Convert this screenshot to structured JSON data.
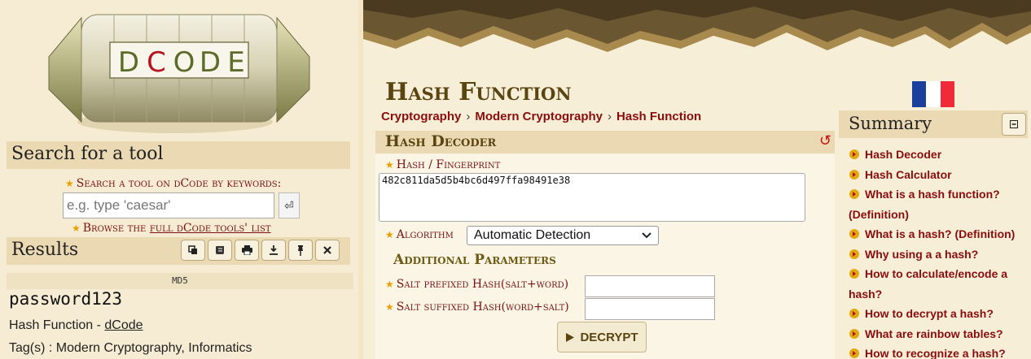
{
  "left": {
    "logo_letters": [
      "D",
      "C",
      "O",
      "D",
      "E"
    ],
    "search_section_title": "Search for a tool",
    "search_label": "Search a tool on dCode by keywords:",
    "search_placeholder": "e.g. type 'caesar'",
    "browse_prefix": "Browse the ",
    "browse_link": "full dCode tools' list",
    "results_section_title": "Results",
    "toolbar_icons": [
      "copy-icon",
      "script-icon",
      "print-icon",
      "download-icon",
      "pin-icon",
      "close-icon"
    ],
    "result_type": "MD5",
    "result_value": "password123",
    "result_source_prefix": "Hash Function - ",
    "result_source_link": "dCode",
    "result_tags": "Tag(s) : Modern Cryptography, Informatics"
  },
  "main": {
    "page_title": "Hash Function",
    "breadcrumb": [
      "Cryptography",
      "Modern Cryptography",
      "Hash Function"
    ],
    "breadcrumb_separator": "›",
    "flag_colors": [
      "#1b3f9c",
      "#ffffff",
      "#ef2b3a"
    ],
    "decoder_title": "Hash Decoder",
    "hash_label": "Hash / Fingerprint",
    "hash_value": "482c811da5d5b4bc6d497ffa98491e38",
    "algorithm_label": "Algorithm",
    "algorithm_value": "Automatic Detection",
    "additional_params_title": "Additional Parameters",
    "salt_prefixed_label": "Salt prefixed Hash(salt+word)",
    "salt_suffixed_label": "Salt suffixed Hash(word+salt)",
    "decrypt_label": "DECRYPT"
  },
  "summary": {
    "title": "Summary",
    "items": [
      "Hash Decoder",
      "Hash Calculator",
      "What is a hash function? (Definition)",
      "What is a hash? (Definition)",
      "Why using a a hash?",
      "How to calculate/encode a hash?",
      "How to decrypt a hash?",
      "What are rainbow tables?",
      "How to recognize a hash?"
    ]
  }
}
